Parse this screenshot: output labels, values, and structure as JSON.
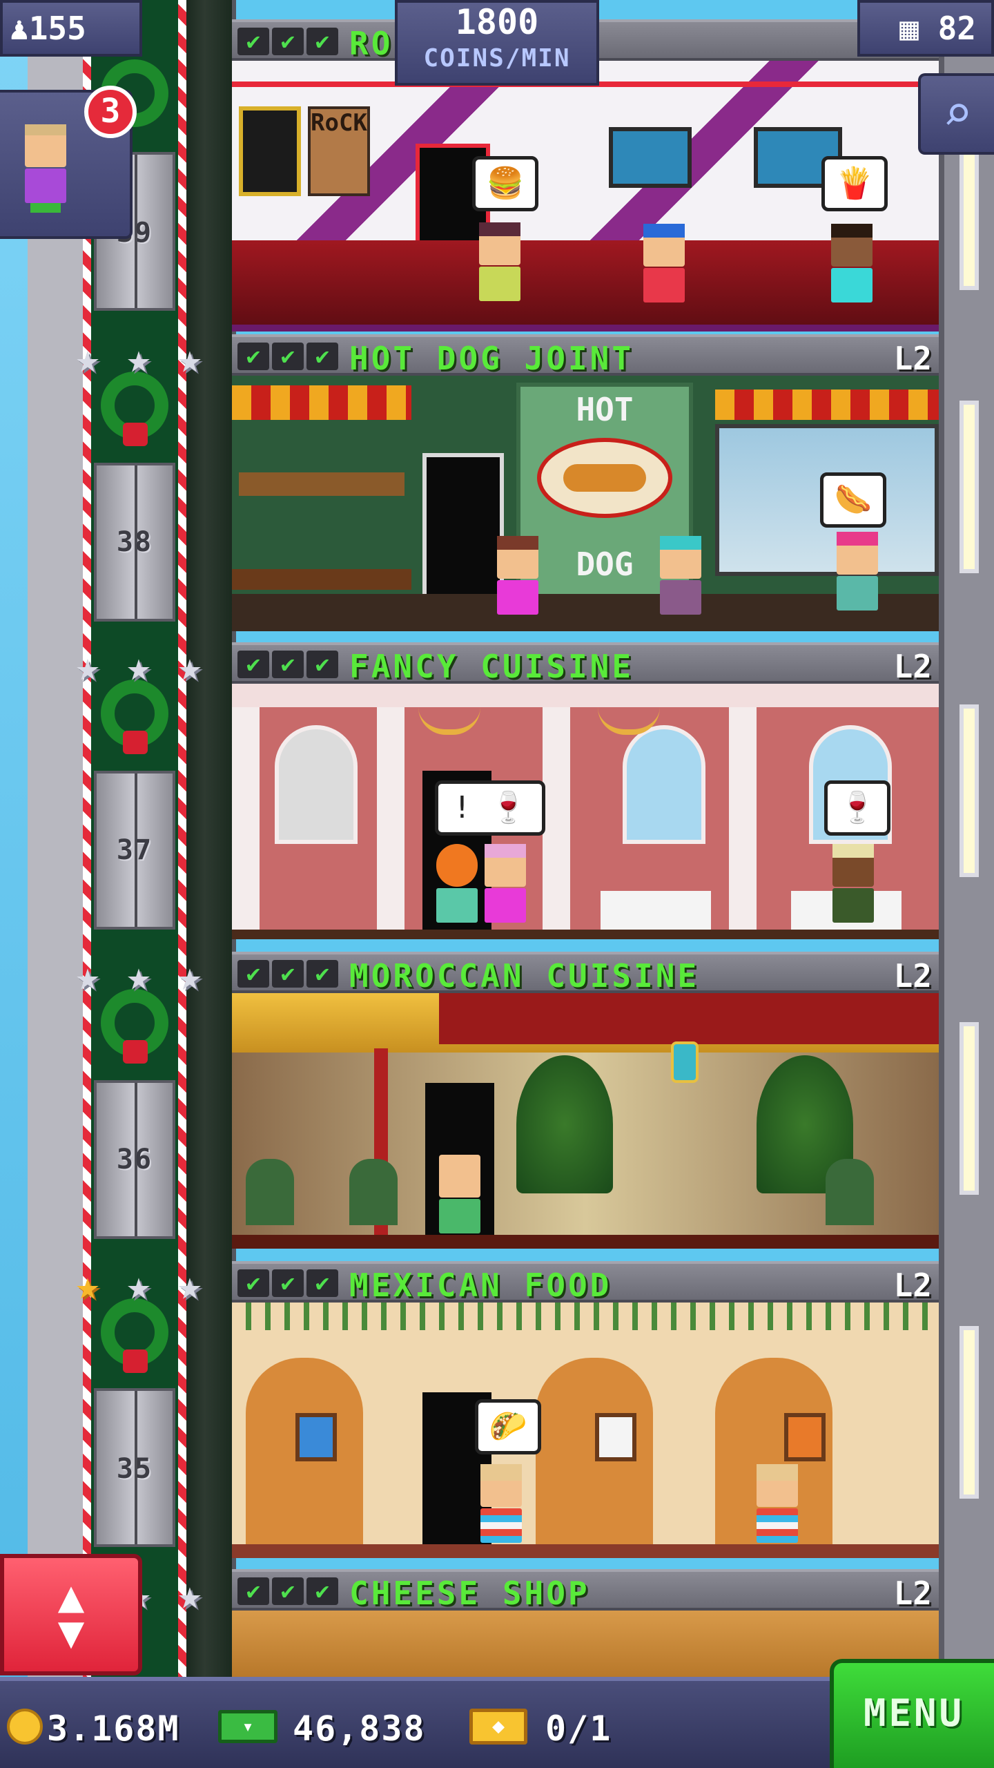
{
  "hud": {
    "population": "155",
    "coins_rate_value": "1800",
    "coins_rate_unit": "COINS/MIN",
    "floor_count": "82",
    "visitor_badge": "3"
  },
  "floors": [
    {
      "label": "RO",
      "level": "",
      "number": "39"
    },
    {
      "label": "HOT DOG JOINT",
      "level": "L2",
      "number": "38"
    },
    {
      "label": "FANCY CUISINE",
      "level": "L2",
      "number": "37"
    },
    {
      "label": "MOROCCAN CUISINE",
      "level": "L2",
      "number": "36"
    },
    {
      "label": "MEXICAN FOOD",
      "level": "L2",
      "number": "35"
    },
    {
      "label": "CHEESE SHOP",
      "level": "L2",
      "number": ""
    }
  ],
  "room_signs": {
    "rock_poster": "RoCK",
    "hotdog_sign_top": "HOT",
    "hotdog_sign_bottom": "DOG"
  },
  "bubbles": {
    "alert": "!"
  },
  "bottom_bar": {
    "coins": "3.168M",
    "bux": "46,838",
    "tickets": "0/1",
    "menu_label": "MENU"
  },
  "icons": [
    "population-icon",
    "floors-icon",
    "search-icon",
    "coin-icon",
    "bux-icon",
    "ticket-icon",
    "elevator-arrows-icon",
    "star-icon",
    "wreath-icon"
  ],
  "colors": {
    "floor_name": "#59ea3a",
    "check": "#4ee04e",
    "menu_green": "#1e9e22",
    "elevator_red": "#e0243a",
    "hud_blue": "#3e4270",
    "badge_red": "#e52a3a"
  }
}
